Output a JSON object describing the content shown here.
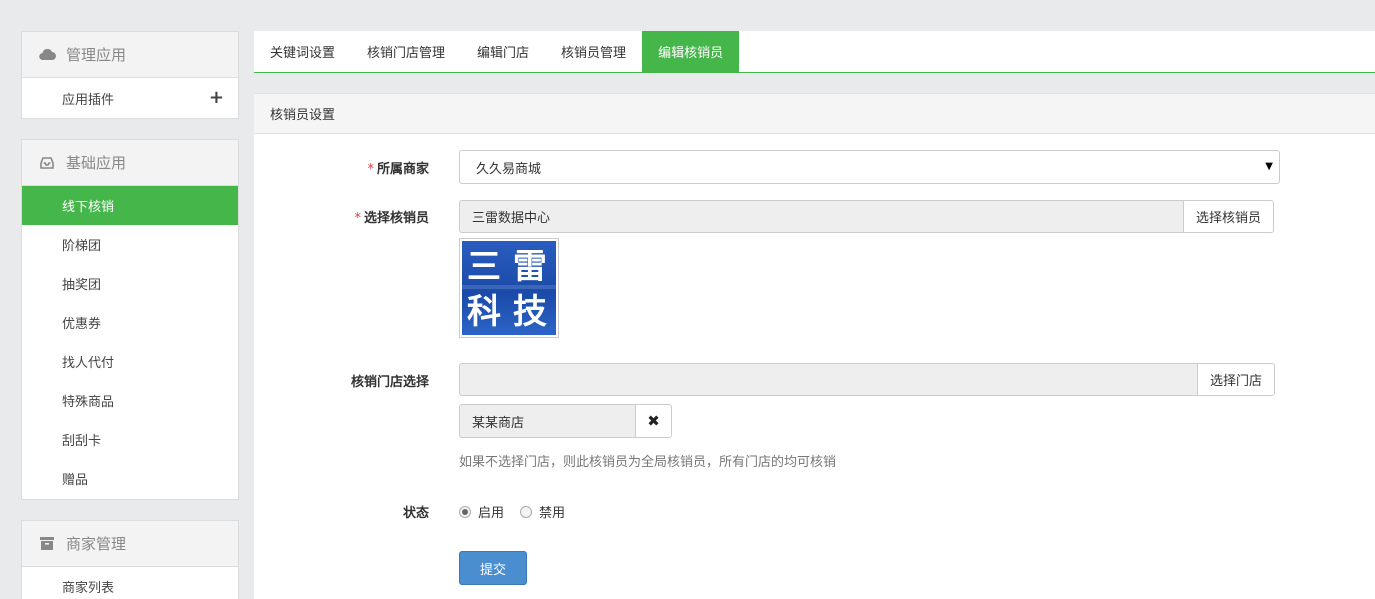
{
  "sidebar": {
    "sections": [
      {
        "title": "管理应用",
        "icon": "cloud-icon",
        "items": [
          {
            "label": "应用插件"
          }
        ]
      },
      {
        "title": "基础应用",
        "icon": "inbox-icon",
        "items": [
          {
            "label": "线下核销",
            "active": true
          },
          {
            "label": "阶梯团"
          },
          {
            "label": "抽奖团"
          },
          {
            "label": "优惠券"
          },
          {
            "label": "找人代付"
          },
          {
            "label": "特殊商品"
          },
          {
            "label": "刮刮卡"
          },
          {
            "label": "赠品"
          }
        ]
      },
      {
        "title": "商家管理",
        "icon": "archive-icon",
        "items": [
          {
            "label": "商家列表"
          }
        ]
      }
    ]
  },
  "tabs": [
    {
      "label": "关键词设置"
    },
    {
      "label": "核销门店管理"
    },
    {
      "label": "编辑门店"
    },
    {
      "label": "核销员管理"
    },
    {
      "label": "编辑核销员",
      "active": true
    }
  ],
  "section_title": "核销员设置",
  "form": {
    "merchant": {
      "required_mark": "*",
      "label": "所属商家",
      "value": "久久易商城"
    },
    "staff": {
      "required_mark": "*",
      "label": "选择核销员",
      "value": "三雷数据中心",
      "button": "选择核销员"
    },
    "avatar": {
      "line1": "三 雷",
      "line2": "科 技"
    },
    "store": {
      "label": "核销门店选择",
      "value": "",
      "button": "选择门店",
      "selected": "某某商店",
      "help": "如果不选择门店，则此核销员为全局核销员，所有门店的均可核销"
    },
    "status": {
      "label": "状态",
      "options": [
        {
          "label": "启用",
          "checked": true
        },
        {
          "label": "禁用",
          "checked": false
        }
      ]
    },
    "submit": "提交"
  },
  "colors": {
    "accent": "#45b649",
    "primary_button": "#4a8ed0"
  }
}
